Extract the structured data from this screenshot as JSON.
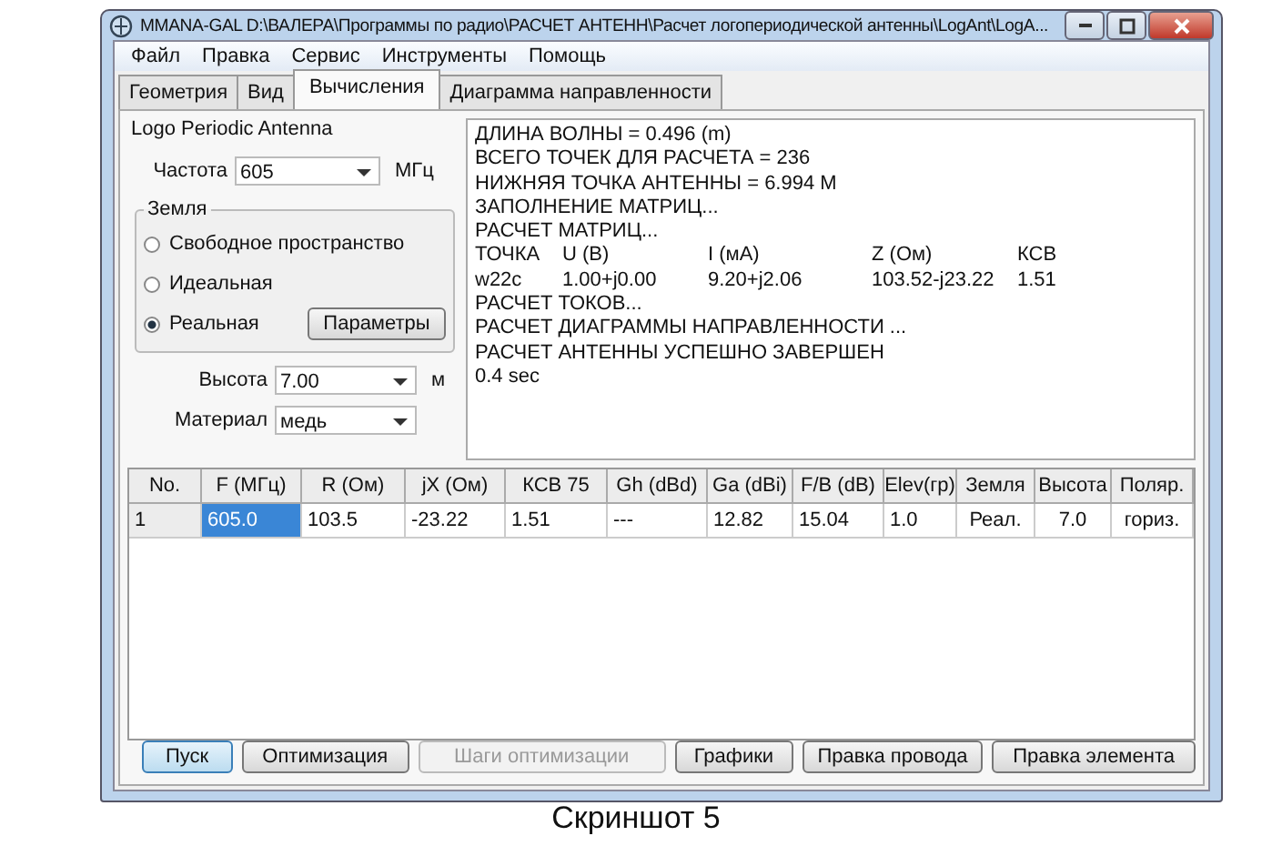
{
  "window": {
    "title": "MMANA-GAL D:\\ВАЛЕРА\\Программы по радио\\РАСЧЕТ АНТЕНН\\Расчет логопериодической антенны\\LogAnt\\LogA..."
  },
  "menu": [
    "Файл",
    "Правка",
    "Сервис",
    "Инструменты",
    "Помощь"
  ],
  "tabs": [
    {
      "label": "Геометрия",
      "selected": false
    },
    {
      "label": "Вид",
      "selected": false
    },
    {
      "label": "Вычисления",
      "selected": true
    },
    {
      "label": "Диаграмма направленности",
      "selected": false
    }
  ],
  "antenna_name": "Logo Periodic Antenna",
  "frequency": {
    "label": "Частота",
    "value": "605",
    "unit": "МГц"
  },
  "ground": {
    "legend": "Земля",
    "options": [
      {
        "label": "Свободное пространство",
        "selected": false
      },
      {
        "label": "Идеальная",
        "selected": false
      },
      {
        "label": "Реальная",
        "selected": true
      }
    ],
    "button": "Параметры"
  },
  "height": {
    "label": "Высота",
    "value": "7.00",
    "unit": "м"
  },
  "material": {
    "label": "Материал",
    "value": "медь"
  },
  "log": [
    {
      "kind": "text",
      "text": "ДЛИНА ВОЛНЫ = 0.496 (m)"
    },
    {
      "kind": "text",
      "text": "ВСЕГО ТОЧЕК ДЛЯ РАСЧЕТА = 236"
    },
    {
      "kind": "text",
      "text": "НИЖНЯЯ ТОЧКА АНТЕННЫ = 6.994 M"
    },
    {
      "kind": "text",
      "text": "ЗАПОЛНЕНИЕ МАТРИЦ..."
    },
    {
      "kind": "text",
      "text": "РАСЧЕТ МАТРИЦ..."
    },
    {
      "kind": "columns",
      "cells": [
        "ТОЧКА",
        "U (B)",
        "I (мА)",
        "Z (Ом)",
        "КСВ"
      ]
    },
    {
      "kind": "columns",
      "cells": [
        "w22c",
        "1.00+j0.00",
        "9.20+j2.06",
        "103.52-j23.22",
        "1.51"
      ]
    },
    {
      "kind": "text",
      "text": "РАСЧЕТ ТОКОВ..."
    },
    {
      "kind": "text",
      "text": "РАСЧЕТ ДИАГРАММЫ НАПРАВЛЕННОСТИ ..."
    },
    {
      "kind": "text",
      "text": "РАСЧЕТ АНТЕННЫ УСПЕШНО ЗАВЕРШЕН"
    },
    {
      "kind": "text",
      "text": "0.4 sec"
    }
  ],
  "table": {
    "columns": [
      "No.",
      "F (МГц)",
      "R (Ом)",
      "jX (Ом)",
      "КСВ 75",
      "Gh (dBd)",
      "Ga (dBi)",
      "F/B (dB)",
      "Elev(гр)",
      "Земля",
      "Высота",
      "Поляр."
    ],
    "rows": [
      {
        "cells": [
          {
            "text": "1",
            "selected": false
          },
          {
            "text": "605.0",
            "selected": true
          },
          {
            "text": "103.5",
            "selected": false
          },
          {
            "text": "-23.22",
            "selected": false
          },
          {
            "text": "1.51",
            "selected": false
          },
          {
            "text": "---",
            "selected": false
          },
          {
            "text": "12.82",
            "selected": false
          },
          {
            "text": "15.04",
            "selected": false
          },
          {
            "text": "1.0",
            "selected": false
          },
          {
            "text": "Реал.",
            "selected": false
          },
          {
            "text": "7.0",
            "selected": false
          },
          {
            "text": "гориз.",
            "selected": false
          }
        ]
      }
    ]
  },
  "buttons": [
    {
      "label": "Пуск",
      "disabled": false,
      "focused": true
    },
    {
      "label": "Оптимизация",
      "disabled": false,
      "focused": false
    },
    {
      "label": "Шаги оптимизации",
      "disabled": true,
      "focused": false
    },
    {
      "label": "Графики",
      "disabled": false,
      "focused": false
    },
    {
      "label": "Правка провода",
      "disabled": false,
      "focused": false
    },
    {
      "label": "Правка элемента",
      "disabled": false,
      "focused": false
    }
  ],
  "caption": "Скриншот 5"
}
